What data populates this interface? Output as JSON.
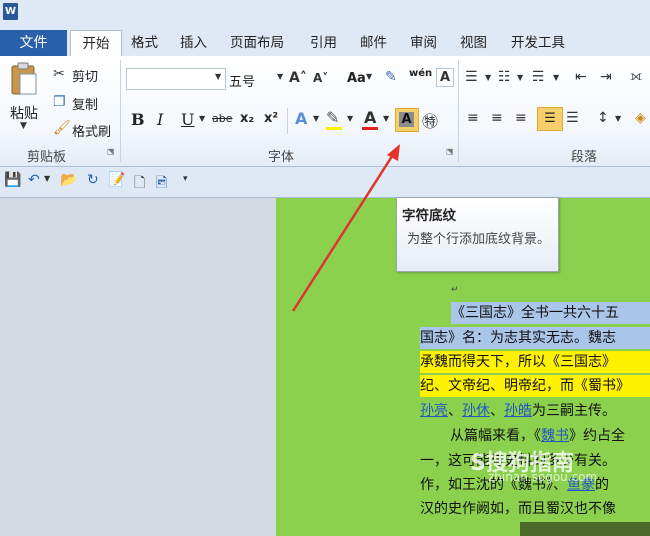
{
  "title": {
    "logo": "W"
  },
  "tabs": [
    "文件",
    "开始",
    "格式",
    "插入",
    "页面布局",
    "引用",
    "邮件",
    "审阅",
    "视图",
    "开发工具"
  ],
  "clipboard": {
    "paste": "粘贴",
    "cut": "剪切",
    "copy": "复制",
    "format_painter": "格式刷",
    "group": "剪贴板"
  },
  "font": {
    "size": "五号",
    "bold": "B",
    "italic": "I",
    "underline": "U",
    "strike": "abe",
    "sub": "x₂",
    "sup": "x²",
    "aa": "Aa",
    "wen": "wén",
    "group": "字体"
  },
  "paragraph": {
    "group": "段落"
  },
  "tooltip": {
    "title": "字符底纹",
    "desc": "为整个行添加底纹背景。"
  },
  "doc": {
    "lines": [
      "《三国志》全书一共六十五",
      "国志》名：为志其实无志。魏志",
      "承魏而得天下，所以《三国志》",
      "纪、文帝纪、明帝纪，而《蜀书》",
      "孙亮、孙休、孙皓为三嗣主传。",
      "从篇幅来看，《魏书》约占全",
      "一，这可能与史料的多少有关。",
      "作，如王沈的《魏书》、鱼豢的",
      "汉的史作阙如，而且蜀汉也不像"
    ],
    "link_words": [
      "孙亮",
      "孙休",
      "孙皓",
      "魏书",
      "鱼豢"
    ]
  },
  "watermark": {
    "text": "S搜狗指南",
    "sub": "zhinan.sogou.com"
  },
  "colors": {
    "page": "#8bd14e",
    "file_tab": "#2a5fa9",
    "highlight": "#fff200",
    "arrow": "#e0342c"
  }
}
